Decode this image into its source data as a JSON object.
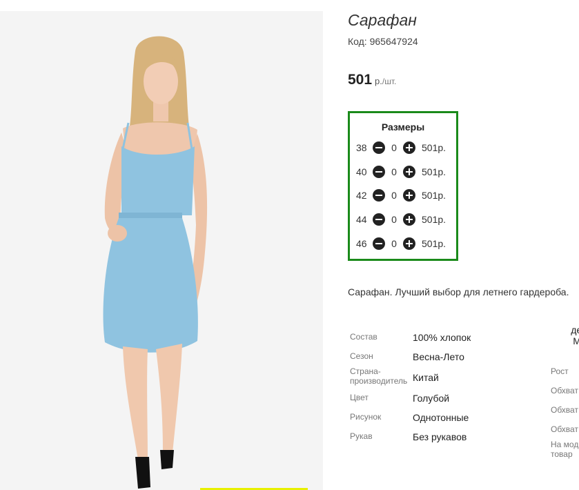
{
  "product": {
    "title": "Сарафан",
    "code": "Код: 965647924",
    "price": "501",
    "price_unit": "р.",
    "price_per": "/шт.",
    "description": "Сарафан. Лучший выбор для летнего гардероба."
  },
  "sizes": {
    "title": "Размеры",
    "rows": [
      {
        "size": "38",
        "qty": "0",
        "price": "501р."
      },
      {
        "size": "40",
        "qty": "0",
        "price": "501р."
      },
      {
        "size": "42",
        "qty": "0",
        "price": "501р."
      },
      {
        "size": "44",
        "qty": "0",
        "price": "501р."
      },
      {
        "size": "46",
        "qty": "0",
        "price": "501р."
      }
    ]
  },
  "specs": [
    {
      "label": "Состав",
      "value": "100% хлопок"
    },
    {
      "label": "Сезон",
      "value": "Весна-Лето"
    },
    {
      "label": "Страна-производитель",
      "value": "Китай"
    },
    {
      "label": "Цвет",
      "value": "Голубой"
    },
    {
      "label": "Рисунок",
      "value": "Однотонные"
    },
    {
      "label": "Рукав",
      "value": "Без рукавов"
    }
  ],
  "model_params": {
    "heading_line1": "дем",
    "heading_line2": "Мо",
    "labels": [
      "Рост",
      "Обхват",
      "Обхват",
      "Обхват",
      "На мод товар"
    ]
  },
  "colors": {
    "accent_border": "#1a8a1a",
    "dress": "#8fc3e0"
  },
  "icons": {
    "minus": "minus-circle-icon",
    "plus": "plus-circle-icon"
  }
}
